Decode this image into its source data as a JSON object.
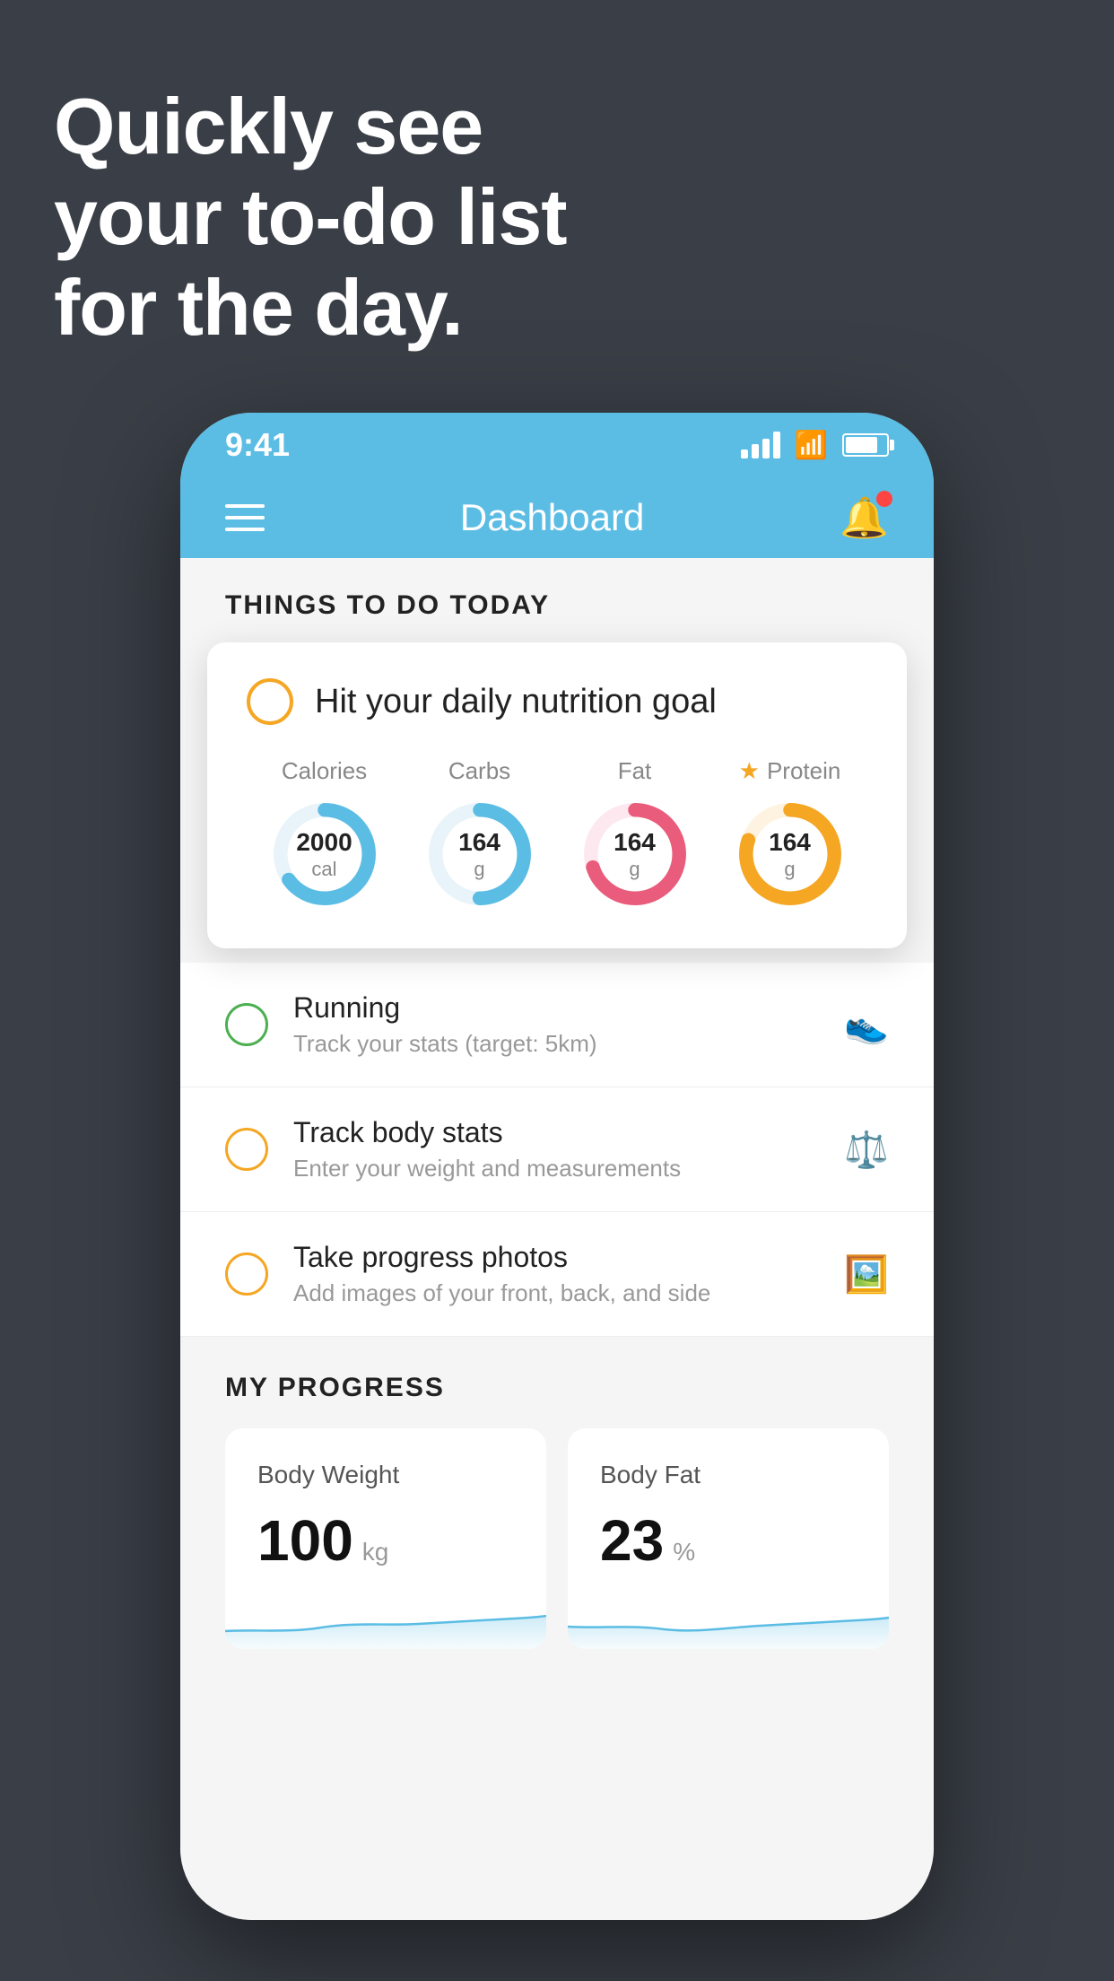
{
  "page": {
    "background_color": "#3a3f47"
  },
  "headline": {
    "line1": "Quickly see",
    "line2": "your to-do list",
    "line3": "for the day."
  },
  "phone": {
    "status_bar": {
      "time": "9:41"
    },
    "nav_bar": {
      "title": "Dashboard"
    },
    "things_section": {
      "title": "THINGS TO DO TODAY"
    },
    "nutrition_card": {
      "title": "Hit your daily nutrition goal",
      "items": [
        {
          "label": "Calories",
          "value": "2000",
          "unit": "cal",
          "color": "#5bbde4",
          "track_pct": 65,
          "starred": false
        },
        {
          "label": "Carbs",
          "value": "164",
          "unit": "g",
          "color": "#5bbde4",
          "track_pct": 50,
          "starred": false
        },
        {
          "label": "Fat",
          "value": "164",
          "unit": "g",
          "color": "#e95c7b",
          "track_pct": 70,
          "starred": false
        },
        {
          "label": "Protein",
          "value": "164",
          "unit": "g",
          "color": "#f5a623",
          "track_pct": 80,
          "starred": true
        }
      ]
    },
    "todo_items": [
      {
        "title": "Running",
        "subtitle": "Track your stats (target: 5km)",
        "circle_color": "green",
        "icon": "shoe"
      },
      {
        "title": "Track body stats",
        "subtitle": "Enter your weight and measurements",
        "circle_color": "yellow",
        "icon": "scale"
      },
      {
        "title": "Take progress photos",
        "subtitle": "Add images of your front, back, and side",
        "circle_color": "yellow",
        "icon": "portrait"
      }
    ],
    "progress_section": {
      "title": "MY PROGRESS",
      "cards": [
        {
          "title": "Body Weight",
          "value": "100",
          "unit": "kg"
        },
        {
          "title": "Body Fat",
          "value": "23",
          "unit": "%"
        }
      ]
    }
  }
}
